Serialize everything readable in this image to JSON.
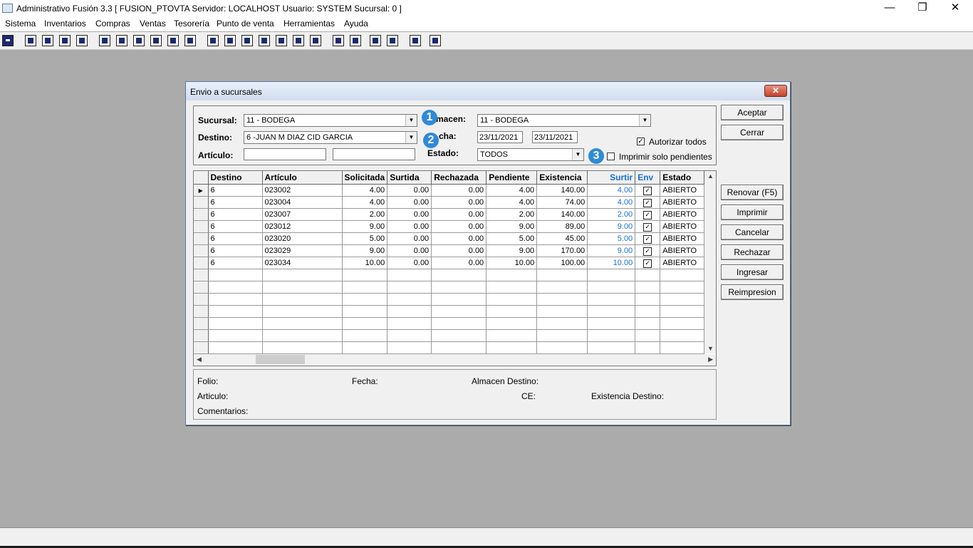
{
  "window": {
    "title": "Administrativo Fusión 3.3 [ FUSION_PTOVTA  Servidor: LOCALHOST  Usuario: SYSTEM    Sucursal: 0 ]",
    "min": "—",
    "restore": "❐",
    "close": "✕"
  },
  "menu": [
    "Sistema",
    "Inventarios",
    "Compras",
    "Ventas",
    "Tesorería",
    "Punto de venta",
    "Herramientas",
    "Ayuda"
  ],
  "dialog": {
    "title": "Envio a sucursales",
    "close": "✕",
    "filters": {
      "sucursal_label": "Sucursal:",
      "sucursal_value": "11 - BODEGA",
      "destino_label": "Destino:",
      "destino_value": "6  -JUAN M DIAZ CID GARCIA",
      "articulo_label": "Artículo:",
      "almacen_label": "macen:",
      "almacen_value": "11 - BODEGA",
      "fecha_label": "cha:",
      "fecha_desde": "23/11/2021",
      "fecha_hasta": "23/11/2021",
      "estado_label": "Estado:",
      "estado_value": "TODOS",
      "autorizar_label": "Autorizar todos",
      "autorizar_checked": "✓",
      "imprimir_label": "Imprimir solo pendientes"
    },
    "badges": [
      "1",
      "2",
      "3"
    ],
    "buttons": {
      "aceptar": "Aceptar",
      "cerrar": "Cerrar",
      "renovar": "Renovar (F5)",
      "imprimir": "Imprimir",
      "cancelar": "Cancelar",
      "rechazar": "Rechazar",
      "ingresar": "Ingresar",
      "reimpresion": "Reimpresion"
    },
    "grid": {
      "headers": [
        "Destino",
        "Artículo",
        "Solicitada",
        "Surtida",
        "Rechazada",
        "Pendiente",
        "Existencia",
        "Surtir",
        "Env",
        "Estado"
      ],
      "rows": [
        [
          "6",
          "023002",
          "4.00",
          "0.00",
          "0.00",
          "4.00",
          "140.00",
          "4.00",
          "✓",
          "ABIERTO"
        ],
        [
          "6",
          "023004",
          "4.00",
          "0.00",
          "0.00",
          "4.00",
          "74.00",
          "4.00",
          "✓",
          "ABIERTO"
        ],
        [
          "6",
          "023007",
          "2.00",
          "0.00",
          "0.00",
          "2.00",
          "140.00",
          "2.00",
          "✓",
          "ABIERTO"
        ],
        [
          "6",
          "023012",
          "9.00",
          "0.00",
          "0.00",
          "9.00",
          "89.00",
          "9.00",
          "✓",
          "ABIERTO"
        ],
        [
          "6",
          "023020",
          "5.00",
          "0.00",
          "0.00",
          "5.00",
          "45.00",
          "5.00",
          "✓",
          "ABIERTO"
        ],
        [
          "6",
          "023029",
          "9.00",
          "0.00",
          "0.00",
          "9.00",
          "170.00",
          "9.00",
          "✓",
          "ABIERTO"
        ],
        [
          "6",
          "023034",
          "10.00",
          "0.00",
          "0.00",
          "10.00",
          "100.00",
          "10.00",
          "✓",
          "ABIERTO"
        ]
      ],
      "row_pointer": "▶"
    },
    "footer": {
      "folio": "Folio:",
      "fecha": "Fecha:",
      "almacen_destino": "Almacen Destino:",
      "articulo": "Articulo:",
      "ce": "CE:",
      "existencia_destino": "Existencia Destino:",
      "comentarios": "Comentarios:"
    }
  }
}
